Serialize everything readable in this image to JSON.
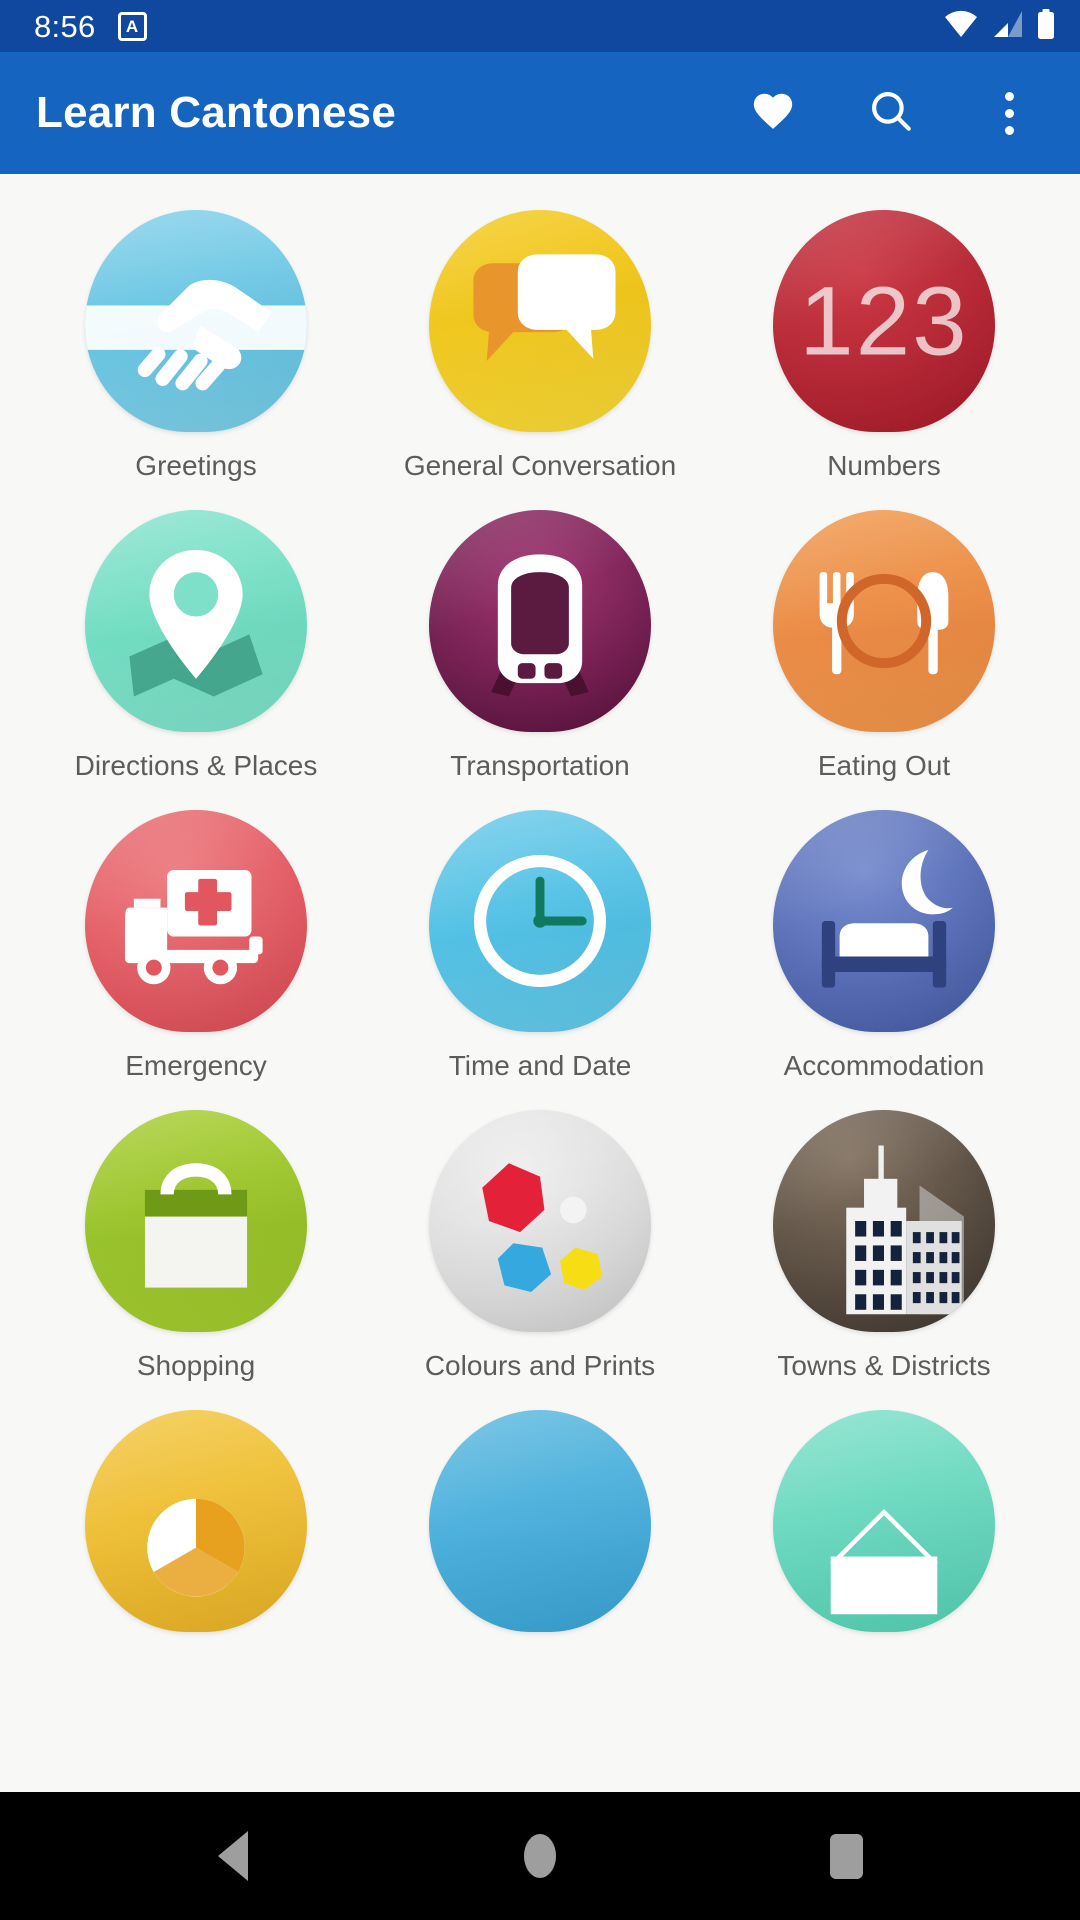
{
  "status_bar": {
    "time": "8:56",
    "app_badge_letter": "A",
    "icons": [
      "wifi-icon",
      "cellular-signal-icon",
      "battery-icon"
    ],
    "background_color": "#10489f"
  },
  "app_bar": {
    "title": "Learn Cantonese",
    "background_color": "#1565c0",
    "actions": [
      {
        "name": "favorites-button",
        "icon": "heart-icon",
        "label": "Favorites"
      },
      {
        "name": "search-button",
        "icon": "search-icon",
        "label": "Search"
      },
      {
        "name": "overflow-menu-button",
        "icon": "more-vertical-icon",
        "label": "More options"
      }
    ]
  },
  "grid": {
    "columns": 3,
    "items": [
      {
        "label": "Greetings",
        "icon": "handshake-icon",
        "color_start": "#7ecde8",
        "color_end": "#5fc0e0"
      },
      {
        "label": "General Conversation",
        "icon": "speech-bubbles-icon",
        "color_start": "#f2c71d",
        "color_end": "#f7d733"
      },
      {
        "label": "Numbers",
        "icon": "numbers-123-icon",
        "color_start": "#b3202f",
        "color_end": "#c8303c"
      },
      {
        "label": "Directions & Places",
        "icon": "map-pin-icon",
        "color_start": "#7fe0c8",
        "color_end": "#6ddcc0"
      },
      {
        "label": "Transportation",
        "icon": "train-icon",
        "color_start": "#5e1140",
        "color_end": "#8e2560"
      },
      {
        "label": "Eating Out",
        "icon": "cutlery-plate-icon",
        "color_start": "#ef9246",
        "color_end": "#e8853c"
      },
      {
        "label": "Emergency",
        "icon": "ambulance-icon",
        "color_start": "#e8646a",
        "color_end": "#e2575f"
      },
      {
        "label": "Time and Date",
        "icon": "clock-icon",
        "color_start": "#63c6e6",
        "color_end": "#4cc0e4"
      },
      {
        "label": "Accommodation",
        "icon": "bed-moon-icon",
        "color_start": "#5a72bd",
        "color_end": "#4a63b2"
      },
      {
        "label": "Shopping",
        "icon": "shopping-bag-icon",
        "color_start": "#9dc62a",
        "color_end": "#93bf22"
      },
      {
        "label": "Colours and Prints",
        "icon": "colour-shapes-icon",
        "color_start": "#e3e3e3",
        "color_end": "#d3d3d3"
      },
      {
        "label": "Towns & Districts",
        "icon": "city-buildings-icon",
        "color_start": "#6b5c4c",
        "color_end": "#4c4038"
      },
      {
        "label": "",
        "icon": "pie-chart-icon",
        "color_start": "#f0c13a",
        "color_end": "#edbb2e"
      },
      {
        "label": "",
        "icon": "blue-tile-icon",
        "color_start": "#56b4dd",
        "color_end": "#44acda"
      },
      {
        "label": "",
        "icon": "teal-tile-icon",
        "color_start": "#74dcc4",
        "color_end": "#62d6bb"
      }
    ]
  },
  "nav_bar": {
    "background_color": "#000000",
    "buttons": [
      {
        "name": "nav-back-button",
        "icon": "triangle-back-icon",
        "label": "Back"
      },
      {
        "name": "nav-home-button",
        "icon": "circle-home-icon",
        "label": "Home"
      },
      {
        "name": "nav-recents-button",
        "icon": "square-recents-icon",
        "label": "Recents"
      }
    ]
  }
}
